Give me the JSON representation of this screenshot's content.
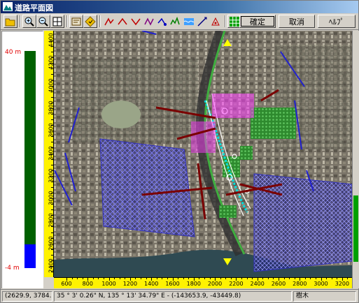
{
  "window": {
    "title": "道路平面図"
  },
  "toolbar": {
    "icons": [
      "open-icon",
      "zoom-in-icon",
      "zoom-out-icon",
      "zoom-fit-icon",
      "tool-a-icon",
      "tool-b-icon",
      "line-tool-1-icon",
      "line-tool-2-icon",
      "line-tool-3-icon",
      "line-tool-4-icon",
      "line-tool-5-icon",
      "line-tool-6-icon",
      "line-tool-7-icon",
      "line-tool-8-icon",
      "line-tool-9-icon",
      "grid-tool-icon",
      "tree-tool-icon",
      "clear-icon"
    ],
    "confirm_label": "確定",
    "cancel_label": "取消",
    "help_label": "ﾍﾙﾌﾟ"
  },
  "height_panel": {
    "top_label": "40 m",
    "bottom_label": "-4 m",
    "level_fraction": 0.11,
    "bar_color": "#006000",
    "level_color": "#0000ff"
  },
  "ruler": {
    "vertical_ticks": [
      "4400",
      "4200",
      "4000",
      "3800",
      "3600",
      "3400",
      "3200",
      "3000",
      "2800",
      "2600",
      "2400"
    ],
    "horizontal_ticks": [
      "600",
      "800",
      "1000",
      "1200",
      "1400",
      "1600",
      "1800",
      "2000",
      "2200",
      "2400",
      "2600",
      "2800",
      "3000",
      "3200"
    ],
    "color": "#fff200"
  },
  "status": {
    "local_coords": "(2629.9, 3784.0)",
    "latlon": "35 °  3' 0.26\" N, 135 °  13' 34.79\" E  - (-143653.9, -43449.8)",
    "layer": "樹木"
  }
}
